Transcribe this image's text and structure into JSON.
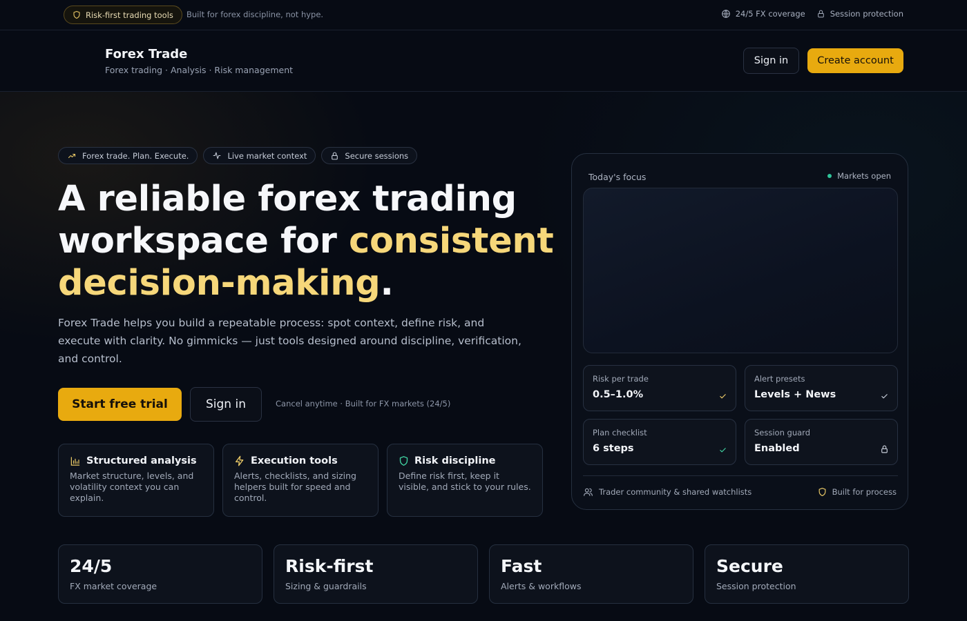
{
  "topbar": {
    "tag_label": "Risk-first trading tools",
    "tagline": "Built for forex discipline, not hype.",
    "coverage": "24/5 FX coverage",
    "protection": "Session protection"
  },
  "header": {
    "brand": "Forex Trade",
    "brand_sub": "Forex trading · Analysis · Risk management",
    "signin": "Sign in",
    "create": "Create account"
  },
  "hero": {
    "chips": [
      "Forex trade. Plan. Execute.",
      "Live market context",
      "Secure sessions"
    ],
    "title_line1": "A reliable forex trading",
    "title_line2_a": "workspace for ",
    "title_line2_b": "consistent",
    "title_line3_a": "decision-making",
    "title_line3_b": ".",
    "description": "Forex Trade helps you build a repeatable process: spot context, define risk, and execute with clarity. No gimmicks — just tools designed around discipline, verification, and control.",
    "cta_primary": "Start free trial",
    "cta_secondary": "Sign in",
    "cta_note": "Cancel anytime · Built for FX markets (24/5)"
  },
  "features": [
    {
      "title": "Structured analysis",
      "desc": "Market structure, levels, and volatility context you can explain.",
      "icon": "bar-chart-icon"
    },
    {
      "title": "Execution tools",
      "desc": "Alerts, checklists, and sizing helpers built for speed and control.",
      "icon": "bolt-icon"
    },
    {
      "title": "Risk discipline",
      "desc": "Define risk first, keep it visible, and stick to your rules.",
      "icon": "shield-icon"
    }
  ],
  "panel": {
    "title": "Today's focus",
    "status": "Markets open",
    "status_color": "#2fc59a",
    "cards": [
      {
        "label": "Risk per trade",
        "value": "0.5–1.0%",
        "icon": "check-icon"
      },
      {
        "label": "Alert presets",
        "value": "Levels + News",
        "icon": "check-icon"
      },
      {
        "label": "Plan checklist",
        "value": "6 steps",
        "icon": "check-icon"
      },
      {
        "label": "Session guard",
        "value": "Enabled",
        "icon": "lock-icon"
      }
    ],
    "footer_left": "Trader community & shared watchlists",
    "footer_right": "Built for process"
  },
  "stats": [
    {
      "value": "24/5",
      "label": "FX market coverage"
    },
    {
      "value": "Risk-first",
      "label": "Sizing & guardrails"
    },
    {
      "value": "Fast",
      "label": "Alerts & workflows"
    },
    {
      "value": "Secure",
      "label": "Session protection"
    }
  ],
  "colors": {
    "accent": "#e8aa0f",
    "accent_text": "#f6d77a",
    "background": "#070b14"
  }
}
